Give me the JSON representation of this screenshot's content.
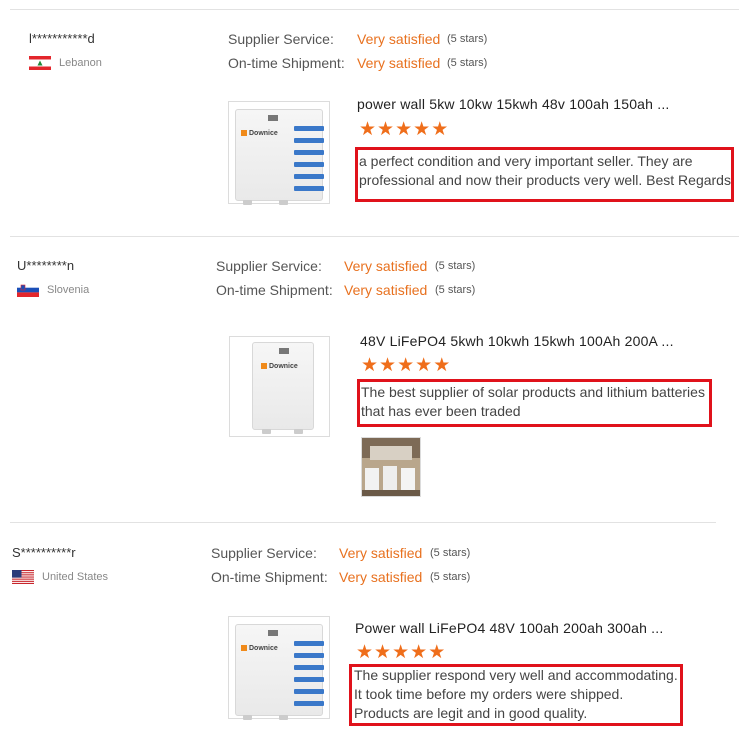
{
  "reviews": [
    {
      "user": "l***********d",
      "country": "Lebanon",
      "service_label": "Supplier Service:",
      "service_value": "Very satisfied",
      "service_stars": "(5 stars)",
      "shipment_label": "On-time Shipment:",
      "shipment_value": "Very satisfied",
      "shipment_stars": "(5 stars)",
      "product_title": "power wall 5kw 10kw 15kwh 48v 100ah 150ah ...",
      "rating": 5,
      "review_lines": [
        "a perfect condition and very important seller. They are",
        "professional and now their products very well. Best Regards"
      ],
      "logo": "Downice"
    },
    {
      "user": "U********n",
      "country": "Slovenia",
      "service_label": "Supplier Service:",
      "service_value": "Very satisfied",
      "service_stars": "(5 stars)",
      "shipment_label": "On-time Shipment:",
      "shipment_value": "Very satisfied",
      "shipment_stars": "(5 stars)",
      "product_title": "48V LiFePO4 5kwh 10kwh 15kwh 100Ah 200A ...",
      "rating": 5,
      "review_lines": [
        "The best supplier of solar products and lithium batteries",
        "that has ever been traded"
      ],
      "logo": "Downice"
    },
    {
      "user": "S**********r",
      "country": "United States",
      "service_label": "Supplier Service:",
      "service_value": "Very satisfied",
      "service_stars": "(5 stars)",
      "shipment_label": "On-time Shipment:",
      "shipment_value": "Very satisfied",
      "shipment_stars": "(5 stars)",
      "product_title": "Power wall LiFePO4 48V 100ah 200ah 300ah ...",
      "rating": 5,
      "review_lines": [
        "The supplier respond very well and accommodating.",
        "It took time before my orders were shipped.",
        "Products are legit and in good quality."
      ],
      "logo": "Downice"
    }
  ],
  "colors": {
    "accent": "#e8711f",
    "star": "#ef6e1b",
    "highlight": "#e0121b"
  },
  "icons": {
    "star": "star-icon"
  }
}
